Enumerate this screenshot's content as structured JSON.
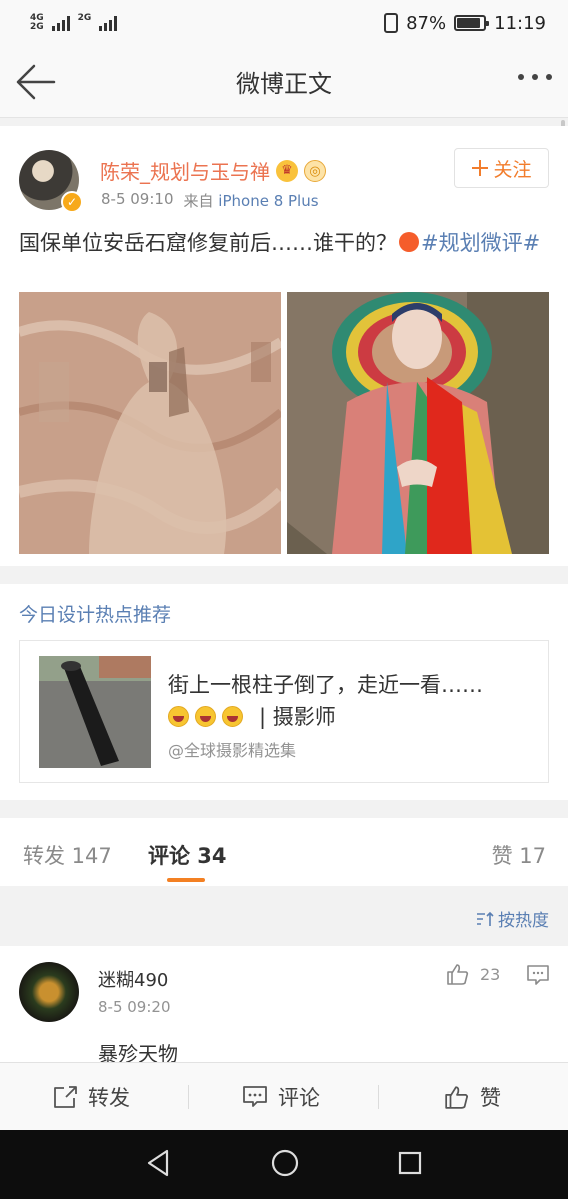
{
  "status_bar": {
    "signal1_label_top": "4G",
    "signal1_label_bottom": "2G",
    "signal2_label": "2G",
    "battery_percent": "87%",
    "battery_level": 0.87,
    "time": "11:19"
  },
  "nav": {
    "title": "微博正文",
    "back_icon": "back-arrow-icon",
    "more_icon": "more-dots-icon"
  },
  "post": {
    "username": "陈荣_规划与玉与禅",
    "date": "8-5 09:10",
    "source_prefix": "来自",
    "source": "iPhone 8 Plus",
    "follow_label": "关注",
    "text": "国保单位安岳石窟修复前后……谁干的？",
    "topic": "#规划微评#",
    "images": [
      "before-restoration-photo",
      "after-restoration-photo"
    ]
  },
  "recommendation": {
    "title": "今日设计热点推荐",
    "card_line1": "街上一根柱子倒了，走近一看……",
    "card_line2_suffix": "|  摄影师",
    "card_source": "@全球摄影精选集"
  },
  "tabs": {
    "repost": "转发 147",
    "comments": "评论 34",
    "likes": "赞 17"
  },
  "sort": {
    "label": "按热度"
  },
  "comment": {
    "name": "迷糊490",
    "time": "8-5 09:20",
    "text": "暴殄天物",
    "likes": "23"
  },
  "actions": {
    "repost": "转发",
    "comment": "评论",
    "like": "赞"
  },
  "colors": {
    "orange": "#f27d2c",
    "link_blue": "#5a7fb3",
    "username_orange": "#eb7350"
  }
}
